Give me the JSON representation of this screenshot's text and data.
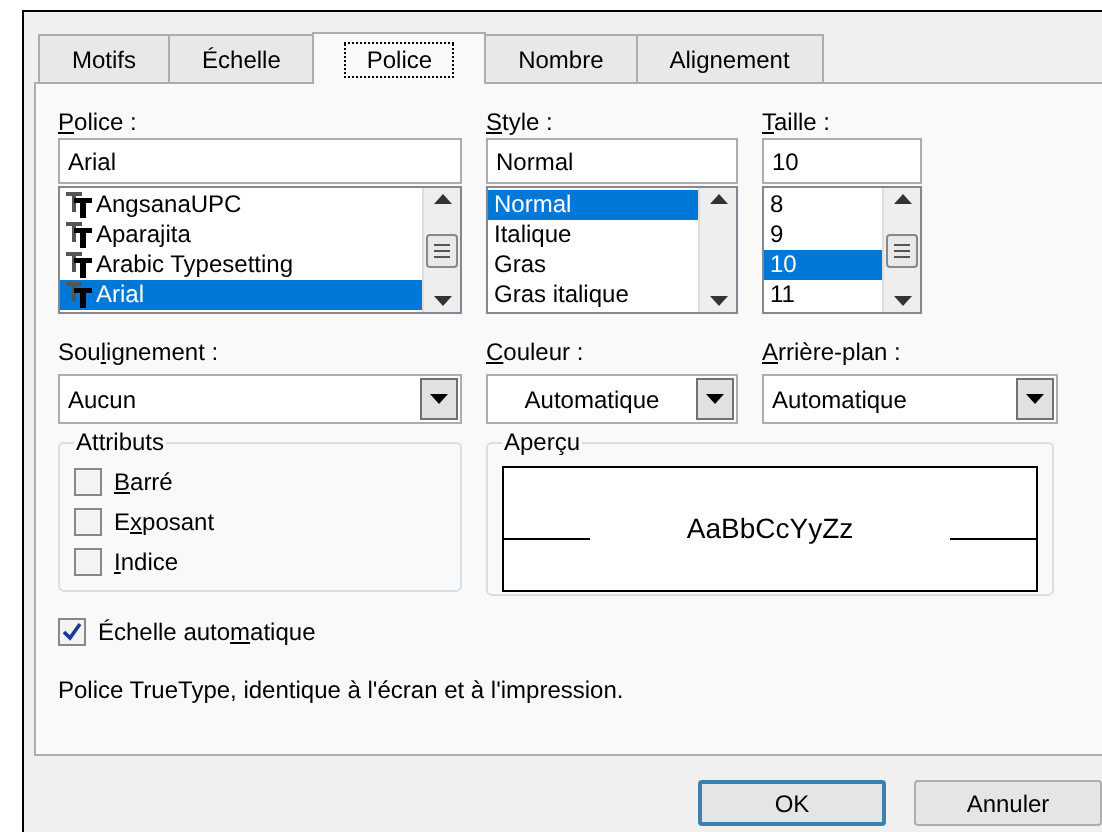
{
  "tabs": [
    {
      "label": "Motifs",
      "selected": false
    },
    {
      "label": "Échelle",
      "selected": false
    },
    {
      "label": "Police",
      "selected": true
    },
    {
      "label": "Nombre",
      "selected": false
    },
    {
      "label": "Alignement",
      "selected": false
    }
  ],
  "font": {
    "label": {
      "key": "P",
      "rest": "olice :"
    },
    "value": "Arial",
    "items": [
      {
        "label": "AngsanaUPC",
        "selected": false
      },
      {
        "label": "Aparajita",
        "selected": false
      },
      {
        "label": "Arabic Typesetting",
        "selected": false
      },
      {
        "label": "Arial",
        "selected": true
      }
    ]
  },
  "style": {
    "label": {
      "key": "S",
      "rest": "tyle :"
    },
    "value": "Normal",
    "items": [
      {
        "label": "Normal",
        "selected": true
      },
      {
        "label": "Italique",
        "selected": false
      },
      {
        "label": "Gras",
        "selected": false
      },
      {
        "label": "Gras italique",
        "selected": false
      }
    ]
  },
  "size": {
    "label": {
      "key": "T",
      "rest": "aille :"
    },
    "value": "10",
    "items": [
      {
        "label": "8",
        "selected": false
      },
      {
        "label": "9",
        "selected": false
      },
      {
        "label": "10",
        "selected": true
      },
      {
        "label": "11",
        "selected": false
      }
    ]
  },
  "underline": {
    "label": {
      "prefix": "Sou",
      "key": "l",
      "rest": "ignement :"
    },
    "value": "Aucun"
  },
  "color": {
    "label": {
      "key": "C",
      "rest": "ouleur :"
    },
    "value": "Automatique"
  },
  "background": {
    "label": {
      "key": "A",
      "rest": "rrière-plan :"
    },
    "value": "Automatique"
  },
  "attributes": {
    "title": "Attributs",
    "items": [
      {
        "label": {
          "key": "B",
          "rest": "arré"
        },
        "checked": false
      },
      {
        "label": {
          "prefix": "E",
          "key": "x",
          "rest": "posant"
        },
        "checked": false
      },
      {
        "label": {
          "key": "I",
          "rest": "ndice"
        },
        "checked": false
      }
    ]
  },
  "preview": {
    "title": "Aperçu",
    "sample": "AaBbCcYyZz"
  },
  "auto_scale": {
    "label": {
      "prefix": "Échelle auto",
      "key": "m",
      "rest": "atique"
    },
    "checked": true
  },
  "info": "Police TrueType, identique à l'écran et à l'impression.",
  "buttons": [
    {
      "label": "OK",
      "default": true
    },
    {
      "label": "Annuler",
      "default": false
    }
  ]
}
